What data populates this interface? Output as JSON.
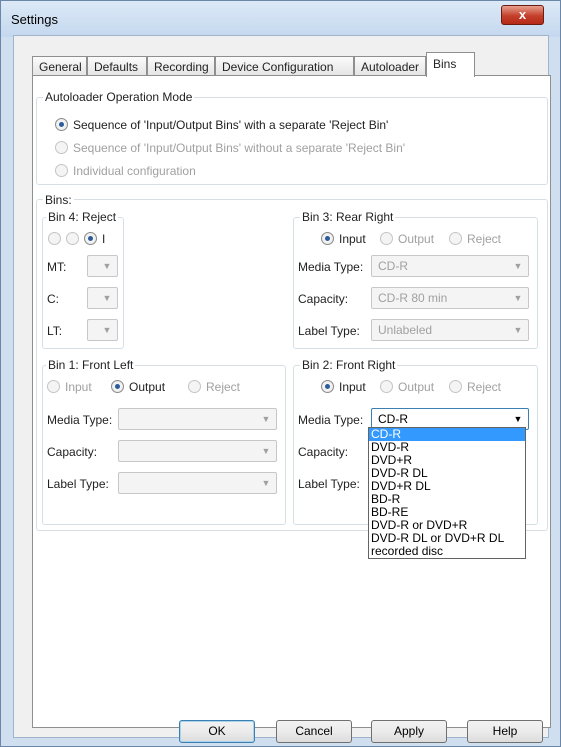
{
  "window": {
    "title": "Settings",
    "close_glyph": "x"
  },
  "tabs": [
    "General",
    "Defaults",
    "Recording",
    "Device Configuration",
    "Autoloader",
    "Bins"
  ],
  "operation_mode": {
    "legend": "Autoloader Operation Mode",
    "options": [
      {
        "label": "Sequence of 'Input/Output Bins' with a separate 'Reject Bin'",
        "checked": true,
        "enabled": true
      },
      {
        "label": "Sequence of 'Input/Output Bins' without a separate 'Reject Bin'",
        "checked": false,
        "enabled": false
      },
      {
        "label": "Individual configuration",
        "checked": false,
        "enabled": false
      }
    ]
  },
  "bins": {
    "legend": "Bins:",
    "bin4": {
      "legend": "Bin 4: Reject",
      "radio_label": "I",
      "fields": [
        "MT:",
        "C:",
        "LT:"
      ]
    },
    "bin3": {
      "legend": "Bin 3: Rear Right",
      "radios": [
        "Input",
        "Output",
        "Reject"
      ],
      "selected": "Input",
      "fields": [
        {
          "label": "Media Type:",
          "value": "CD-R"
        },
        {
          "label": "Capacity:",
          "value": "CD-R 80 min"
        },
        {
          "label": "Label Type:",
          "value": "Unlabeled"
        }
      ]
    },
    "bin1": {
      "legend": "Bin 1: Front Left",
      "radios": [
        "Input",
        "Output",
        "Reject"
      ],
      "selected": "Output",
      "fields": [
        {
          "label": "Media Type:",
          "value": ""
        },
        {
          "label": "Capacity:",
          "value": ""
        },
        {
          "label": "Label Type:",
          "value": ""
        }
      ]
    },
    "bin2": {
      "legend": "Bin 2: Front Right",
      "radios": [
        "Input",
        "Output",
        "Reject"
      ],
      "selected": "Input",
      "fields": [
        {
          "label": "Media Type:",
          "value": "CD-R"
        },
        {
          "label": "Capacity:",
          "value": ""
        },
        {
          "label": "Label Type:",
          "value": ""
        }
      ]
    }
  },
  "media_dropdown": {
    "options": [
      "CD-R",
      "DVD-R",
      "DVD+R",
      "DVD-R DL",
      "DVD+R DL",
      "BD-R",
      "BD-RE",
      "DVD-R or DVD+R",
      "DVD-R DL or DVD+R DL",
      "recorded disc"
    ],
    "highlighted": "CD-R"
  },
  "buttons": {
    "ok": "OK",
    "cancel": "Cancel",
    "apply": "Apply",
    "help": "Help"
  }
}
